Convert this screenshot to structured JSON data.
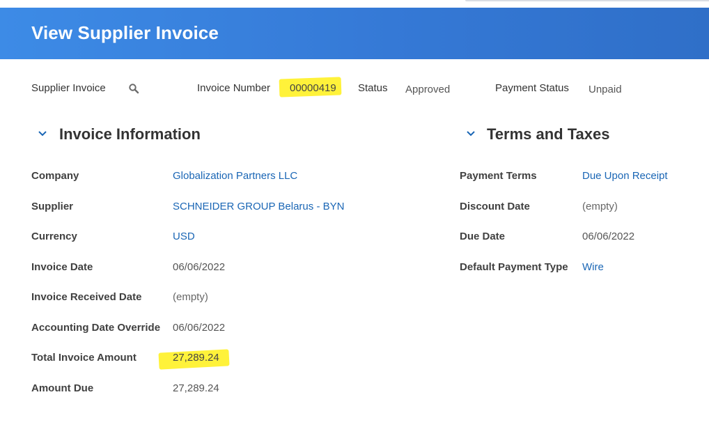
{
  "page": {
    "title": "View Supplier Invoice"
  },
  "summary": {
    "supplier_invoice_label": "Supplier Invoice",
    "invoice_number_label": "Invoice Number",
    "invoice_number_value": "00000419",
    "status_label": "Status",
    "status_value": "Approved",
    "payment_status_label": "Payment Status",
    "payment_status_value": "Unpaid"
  },
  "invoice_info": {
    "title": "Invoice Information",
    "fields": [
      {
        "label": "Company",
        "value": "Globalization Partners LLC"
      },
      {
        "label": "Supplier",
        "value": "SCHNEIDER GROUP Belarus - BYN"
      },
      {
        "label": "Currency",
        "value": "USD"
      },
      {
        "label": "Invoice Date",
        "value": "06/06/2022"
      },
      {
        "label": "Invoice Received Date",
        "value": "(empty)"
      },
      {
        "label": "Accounting Date Override",
        "value": "06/06/2022"
      },
      {
        "label": "Total Invoice Amount",
        "value": "27,289.24"
      },
      {
        "label": "Amount Due",
        "value": "27,289.24"
      }
    ]
  },
  "terms_taxes": {
    "title": "Terms and Taxes",
    "fields": [
      {
        "label": "Payment Terms",
        "value": "Due Upon Receipt"
      },
      {
        "label": "Discount Date",
        "value": "(empty)"
      },
      {
        "label": "Due Date",
        "value": "06/06/2022"
      },
      {
        "label": "Default Payment Type",
        "value": "Wire"
      }
    ]
  },
  "colors": {
    "header": "#3579d6",
    "link": "#1a66b5",
    "highlight": "#fff23a"
  }
}
